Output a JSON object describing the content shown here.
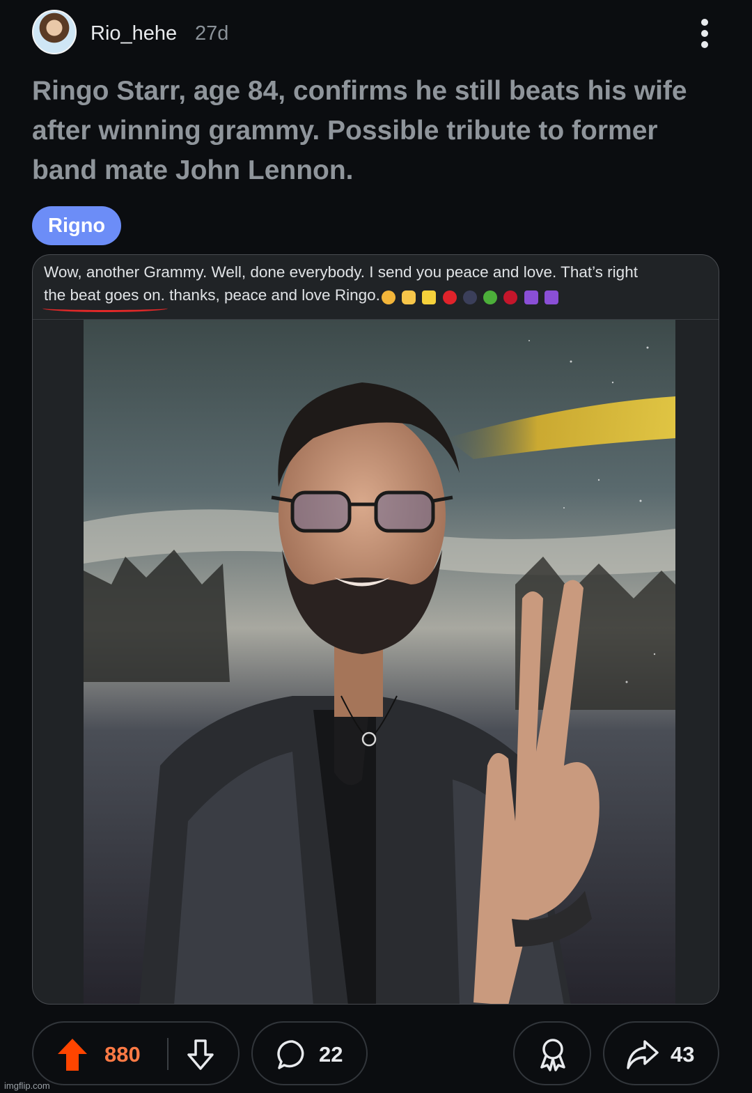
{
  "post": {
    "username": "Rio_hehe",
    "age": "27d",
    "title": "Ringo Starr, age 84, confirms he still beats his wife after winning grammy. Possible tribute to former band mate John Lennon.",
    "flair": "Rigno"
  },
  "media": {
    "line1": "Wow, another Grammy. Well, done everybody. I send you peace and love. That’s right",
    "underlined": "the beat goes on.",
    "line2_rest": " thanks, peace and love Ringo.",
    "emojis": [
      "sunglasses-emoji",
      "victory-hand-emoji",
      "sparkle-emoji",
      "red-heart-emoji",
      "stars-emoji",
      "broccoli-emoji",
      "cherries-emoji",
      "peace-symbol-emoji",
      "peace-symbol-emoji"
    ]
  },
  "actions": {
    "upvotes": "880",
    "comments": "22",
    "shares": "43"
  },
  "colors": {
    "upvote": "#ff4500",
    "flair": "#6c8df7",
    "background": "#0b0d10"
  },
  "watermark": "imgflip.com"
}
